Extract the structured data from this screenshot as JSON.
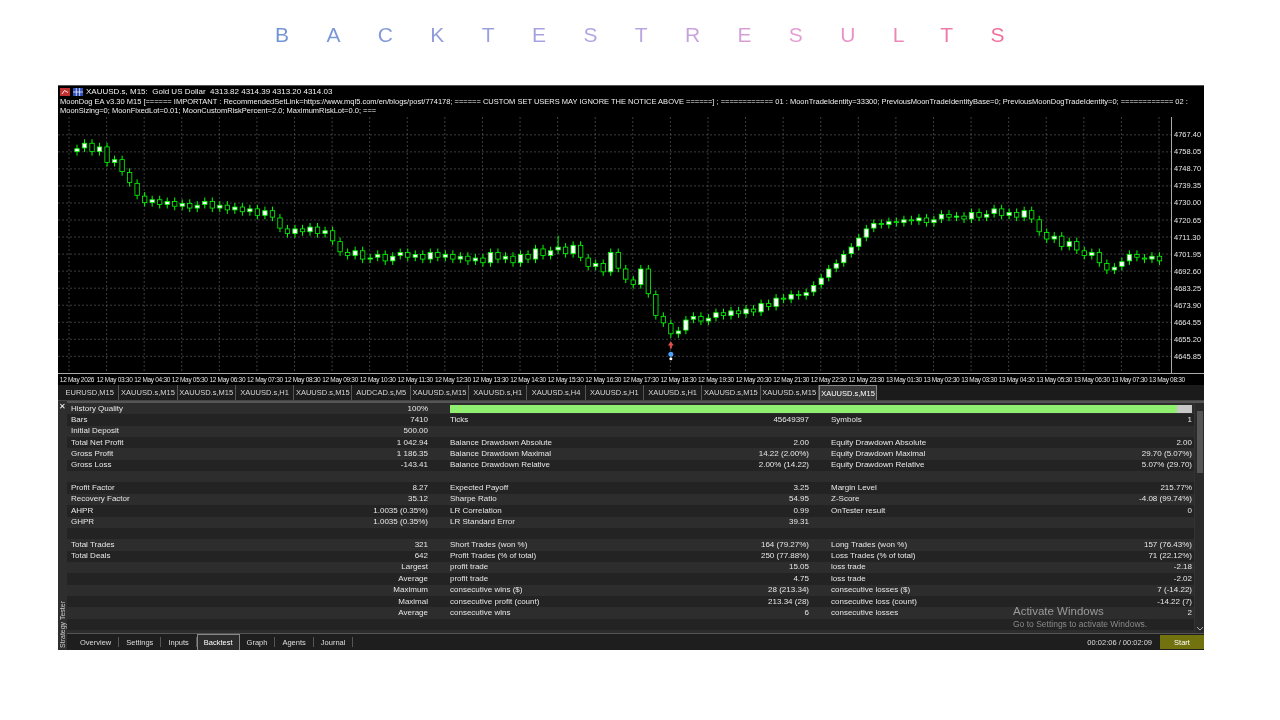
{
  "title": "BACKTEST RESULTS",
  "chart": {
    "header_line": "XAUUSD.s, M15:  Gold US Dollar  4313.82 4314.39 4313.20 4314.03",
    "ea_line": "MoonDog EA v3.30 M15 [====== IMPORTANT : RecommendedSetLink=https://www.mql5.com/en/blogs/post/774178; ====== CUSTOM SET USERS MAY IGNORE THE NOTICE ABOVE ======] ; ============ 01 : MoonTradeIdentity=33300; PreviousMoonTradeIdentityBase=0; PreviousMoonDogTradeIdentity=0; ============ 02 : MoonSizing=0; MoonFixedLot=0.01; MoonCustomRiskPercent=2.0; MaximumRiskLot=0.0; ===",
    "chart_data": {
      "type": "candlestick",
      "categories": [
        "12 May 2026",
        null,
        null,
        null,
        null,
        "12 May 03:30",
        null,
        null,
        null,
        null,
        "12 May 04:30",
        null,
        null,
        null,
        null,
        "12 May 05:30",
        null,
        null,
        null,
        null,
        "12 May 06:30",
        null,
        null,
        null,
        null,
        "12 May 07:30",
        null,
        null,
        null,
        null,
        "12 May 08:30",
        null,
        null,
        null,
        null,
        "12 May 09:30",
        null,
        null,
        null,
        null,
        "12 May 10:30",
        null,
        null,
        null,
        null,
        "12 May 11:30",
        null,
        null,
        null,
        null,
        "12 May 12:30",
        null,
        null,
        null,
        null,
        "12 May 13:30",
        null,
        null,
        null,
        null,
        "12 May 14:30",
        null,
        null,
        null,
        null,
        "12 May 15:30",
        null,
        null,
        null,
        null,
        "12 May 16:30",
        null,
        null,
        null,
        null,
        "12 May 17:30",
        null,
        null,
        null,
        null,
        "12 May 18:30",
        null,
        null,
        null,
        null,
        "12 May 19:30",
        null,
        null,
        null,
        null,
        "12 May 20:30",
        null,
        null,
        null,
        null,
        "12 May 21:30",
        null,
        null,
        null,
        null,
        "12 May 22:30",
        null,
        null,
        null,
        null,
        "12 May 23:30",
        null,
        null,
        null,
        null,
        "13 May 01:30",
        null,
        null,
        null,
        null,
        "13 May 02:30",
        null,
        null,
        null,
        null,
        "13 May 03:30",
        null,
        null,
        null,
        null,
        "13 May 04:30",
        null,
        null,
        null,
        null,
        "13 May 05:30",
        null,
        null,
        null,
        null,
        "13 May 06:30",
        null,
        null,
        null,
        null,
        "13 May 07:30",
        null,
        null,
        null,
        null,
        "13 May 08:30"
      ],
      "grid": true,
      "ylim": [
        4636.7,
        4777.19
      ],
      "ohlc": [
        [
          4758,
          4762,
          4756,
          4760
        ],
        [
          4760,
          4765,
          4758,
          4763
        ],
        [
          4763,
          4765,
          4756,
          4758
        ],
        [
          4758,
          4763,
          4756,
          4761
        ],
        [
          4761,
          4763,
          4750,
          4752
        ],
        [
          4752,
          4756,
          4750,
          4754
        ],
        [
          4754,
          4756,
          4745,
          4747
        ],
        [
          4747,
          4749,
          4739,
          4741
        ],
        [
          4741,
          4743,
          4732,
          4734
        ],
        [
          4734,
          4736,
          4728,
          4730
        ],
        [
          4730,
          4734,
          4728,
          4732
        ],
        [
          4732,
          4734,
          4727,
          4729
        ],
        [
          4729,
          4733,
          4727,
          4731
        ],
        [
          4731,
          4733,
          4726,
          4728
        ],
        [
          4728,
          4732,
          4726,
          4730
        ],
        [
          4730,
          4732,
          4725,
          4727
        ],
        [
          4727,
          4731,
          4725,
          4729
        ],
        [
          4729,
          4733,
          4727,
          4731
        ],
        [
          4731,
          4733,
          4725,
          4727
        ],
        [
          4727,
          4731,
          4725,
          4729
        ],
        [
          4729,
          4731,
          4724,
          4726
        ],
        [
          4726,
          4730,
          4724,
          4728
        ],
        [
          4728,
          4730,
          4723,
          4725
        ],
        [
          4725,
          4729,
          4723,
          4727
        ],
        [
          4727,
          4729,
          4721,
          4723
        ],
        [
          4723,
          4728,
          4721,
          4726
        ],
        [
          4726,
          4728,
          4720,
          4722
        ],
        [
          4722,
          4724,
          4714,
          4716
        ],
        [
          4716,
          4718,
          4711,
          4713
        ],
        [
          4713,
          4718,
          4711,
          4716
        ],
        [
          4716,
          4718,
          4712,
          4714
        ],
        [
          4714,
          4719,
          4712,
          4717
        ],
        [
          4717,
          4719,
          4711,
          4713
        ],
        [
          4713,
          4717,
          4711,
          4715
        ],
        [
          4715,
          4717,
          4707,
          4709
        ],
        [
          4709,
          4711,
          4701,
          4703
        ],
        [
          4703,
          4705,
          4699,
          4701
        ],
        [
          4701,
          4706,
          4699,
          4704
        ],
        [
          4704,
          4706,
          4697,
          4699
        ],
        [
          4699,
          4702,
          4697,
          4700
        ],
        [
          4700,
          4704,
          4698,
          4702
        ],
        [
          4702,
          4704,
          4696,
          4698
        ],
        [
          4698,
          4703,
          4696,
          4701
        ],
        [
          4701,
          4705,
          4699,
          4703
        ],
        [
          4703,
          4705,
          4698,
          4700
        ],
        [
          4700,
          4704,
          4698,
          4702
        ],
        [
          4702,
          4704,
          4697,
          4699
        ],
        [
          4699,
          4705,
          4697,
          4703
        ],
        [
          4703,
          4705,
          4698,
          4700
        ],
        [
          4700,
          4704,
          4698,
          4702
        ],
        [
          4702,
          4704,
          4697,
          4699
        ],
        [
          4699,
          4703,
          4697,
          4701
        ],
        [
          4701,
          4703,
          4696,
          4698
        ],
        [
          4698,
          4702,
          4696,
          4700
        ],
        [
          4700,
          4702,
          4695,
          4697
        ],
        [
          4697,
          4705,
          4695,
          4703
        ],
        [
          4703,
          4705,
          4697,
          4699
        ],
        [
          4699,
          4703,
          4697,
          4701
        ],
        [
          4701,
          4703,
          4695,
          4697
        ],
        [
          4697,
          4704,
          4695,
          4702
        ],
        [
          4702,
          4704,
          4697,
          4699
        ],
        [
          4699,
          4707,
          4697,
          4705
        ],
        [
          4705,
          4707,
          4699,
          4701
        ],
        [
          4701,
          4706,
          4699,
          4704
        ],
        [
          4704,
          4712,
          4702,
          4706
        ],
        [
          4706,
          4708,
          4700,
          4702
        ],
        [
          4702,
          4709,
          4700,
          4707
        ],
        [
          4707,
          4709,
          4698,
          4700
        ],
        [
          4700,
          4702,
          4693,
          4695
        ],
        [
          4695,
          4699,
          4693,
          4697
        ],
        [
          4697,
          4699,
          4690,
          4692
        ],
        [
          4692,
          4705,
          4690,
          4703
        ],
        [
          4703,
          4705,
          4692,
          4694
        ],
        [
          4694,
          4696,
          4686,
          4688
        ],
        [
          4688,
          4690,
          4683,
          4685
        ],
        [
          4685,
          4696,
          4683,
          4694
        ],
        [
          4694,
          4696,
          4678,
          4680
        ],
        [
          4680,
          4682,
          4666,
          4668
        ],
        [
          4668,
          4670,
          4662,
          4664
        ],
        [
          4664,
          4666,
          4656,
          4658
        ],
        [
          4658,
          4662,
          4656,
          4660
        ],
        [
          4660,
          4668,
          4658,
          4666
        ],
        [
          4666,
          4670,
          4664,
          4668
        ],
        [
          4668,
          4670,
          4663,
          4665
        ],
        [
          4665,
          4669,
          4663,
          4667
        ],
        [
          4667,
          4672,
          4665,
          4670
        ],
        [
          4670,
          4672,
          4666,
          4668
        ],
        [
          4668,
          4673,
          4666,
          4671
        ],
        [
          4671,
          4673,
          4667,
          4669
        ],
        [
          4669,
          4674,
          4667,
          4672
        ],
        [
          4672,
          4674,
          4668,
          4670
        ],
        [
          4670,
          4677,
          4668,
          4675
        ],
        [
          4675,
          4677,
          4671,
          4673
        ],
        [
          4673,
          4680,
          4671,
          4678
        ],
        [
          4678,
          4680,
          4675,
          4677
        ],
        [
          4677,
          4682,
          4675,
          4680
        ],
        [
          4680,
          4682,
          4677,
          4679
        ],
        [
          4679,
          4683,
          4677,
          4681
        ],
        [
          4681,
          4687,
          4679,
          4685
        ],
        [
          4685,
          4691,
          4683,
          4689
        ],
        [
          4689,
          4696,
          4687,
          4694
        ],
        [
          4694,
          4699,
          4692,
          4697
        ],
        [
          4697,
          4704,
          4695,
          4702
        ],
        [
          4702,
          4708,
          4700,
          4706
        ],
        [
          4706,
          4713,
          4704,
          4711
        ],
        [
          4711,
          4718,
          4709,
          4716
        ],
        [
          4716,
          4721,
          4714,
          4719
        ],
        [
          4719,
          4721,
          4716,
          4718
        ],
        [
          4718,
          4722,
          4716,
          4720
        ],
        [
          4720,
          4722,
          4717,
          4719
        ],
        [
          4719,
          4723,
          4717,
          4721
        ],
        [
          4721,
          4723,
          4718,
          4720
        ],
        [
          4720,
          4724,
          4718,
          4722
        ],
        [
          4722,
          4724,
          4717,
          4719
        ],
        [
          4719,
          4723,
          4717,
          4721
        ],
        [
          4721,
          4726,
          4719,
          4724
        ],
        [
          4724,
          4726,
          4720,
          4722
        ],
        [
          4722,
          4725,
          4720,
          4723
        ],
        [
          4723,
          4725,
          4719,
          4721
        ],
        [
          4721,
          4727,
          4719,
          4725
        ],
        [
          4725,
          4727,
          4720,
          4722
        ],
        [
          4722,
          4726,
          4720,
          4724
        ],
        [
          4724,
          4729,
          4722,
          4727
        ],
        [
          4727,
          4729,
          4721,
          4723
        ],
        [
          4723,
          4727,
          4721,
          4725
        ],
        [
          4725,
          4727,
          4720,
          4722
        ],
        [
          4722,
          4728,
          4720,
          4726
        ],
        [
          4726,
          4728,
          4719,
          4721
        ],
        [
          4721,
          4723,
          4712,
          4714
        ],
        [
          4714,
          4716,
          4708,
          4710
        ],
        [
          4710,
          4714,
          4708,
          4712
        ],
        [
          4712,
          4714,
          4704,
          4706
        ],
        [
          4706,
          4711,
          4704,
          4709
        ],
        [
          4709,
          4711,
          4702,
          4704
        ],
        [
          4704,
          4706,
          4699,
          4701
        ],
        [
          4701,
          4705,
          4699,
          4703
        ],
        [
          4703,
          4705,
          4695,
          4697
        ],
        [
          4697,
          4699,
          4691,
          4693
        ],
        [
          4693,
          4697,
          4691,
          4695
        ],
        [
          4695,
          4700,
          4693,
          4698
        ],
        [
          4698,
          4704,
          4696,
          4702
        ],
        [
          4702,
          4704,
          4698,
          4700
        ],
        [
          4700,
          4702,
          4697,
          4699
        ],
        [
          4699,
          4703,
          4697,
          4701
        ],
        [
          4701,
          4703,
          4696,
          4698
        ],
        null
      ],
      "yticks": [
        {
          "value": 4767.4,
          "label": "4767.40"
        },
        {
          "value": 4758.05,
          "label": "4758.05"
        },
        {
          "value": 4748.7,
          "label": "4748.70"
        },
        {
          "value": 4739.35,
          "label": "4739.35"
        },
        {
          "value": 4730.0,
          "label": "4730.00"
        },
        {
          "value": 4720.65,
          "label": "4720.65"
        },
        {
          "value": 4711.3,
          "label": "4711.30"
        },
        {
          "value": 4701.95,
          "label": "4701.95"
        },
        {
          "value": 4692.6,
          "label": "4692.60"
        },
        {
          "value": 4683.25,
          "label": "4683.25"
        },
        {
          "value": 4673.9,
          "label": "4673.90"
        },
        {
          "value": 4664.55,
          "label": "4664.55"
        },
        {
          "value": 4655.2,
          "label": "4655.20"
        },
        {
          "value": 4645.85,
          "label": "4645.85"
        }
      ]
    }
  },
  "symbol_tabs": [
    {
      "label": "EURUSD,M15",
      "selected": false
    },
    {
      "label": "XAUUSD.s,M15",
      "selected": false
    },
    {
      "label": "XAUUSD.s,M15",
      "selected": false
    },
    {
      "label": "XAUUSD.s,H1",
      "selected": false
    },
    {
      "label": "XAUUSD.s,M15",
      "selected": false
    },
    {
      "label": "AUDCAD.s,M5",
      "selected": false
    },
    {
      "label": "XAUUSD.s,M15",
      "selected": false
    },
    {
      "label": "XAUUSD.s,H1",
      "selected": false
    },
    {
      "label": "XAUUSD.s,H4",
      "selected": false
    },
    {
      "label": "XAUUSD.s,H1",
      "selected": false
    },
    {
      "label": "XAUUSD.s,H1",
      "selected": false
    },
    {
      "label": "XAUUSD.s,M15",
      "selected": false
    },
    {
      "label": "XAUUSD.s,M15",
      "selected": false
    },
    {
      "label": "XAUUSD.s,M15",
      "selected": true
    }
  ],
  "results": {
    "rows": [
      {
        "kind": "quality",
        "label": "History Quality",
        "value": "100%",
        "level": 0.98
      },
      {
        "kind": "stat",
        "cols": [
          {
            "label": "Bars",
            "value": "7410"
          },
          {
            "label": "Ticks",
            "value": "45649397"
          },
          {
            "label": "Symbols",
            "value": "1"
          }
        ]
      },
      {
        "kind": "stat",
        "cols": [
          {
            "label": "Initial Deposit",
            "value": "500.00"
          }
        ]
      },
      {
        "kind": "stat",
        "cols": [
          {
            "label": "Total Net Profit",
            "value": "1 042.94"
          },
          {
            "label": "Balance Drawdown Absolute",
            "value": "2.00"
          },
          {
            "label": "Equity Drawdown Absolute",
            "value": "2.00"
          }
        ]
      },
      {
        "kind": "stat",
        "cols": [
          {
            "label": "Gross Profit",
            "value": "1 186.35"
          },
          {
            "label": "Balance Drawdown Maximal",
            "value": "14.22 (2.00%)"
          },
          {
            "label": "Equity Drawdown Maximal",
            "value": "29.70 (5.07%)"
          }
        ]
      },
      {
        "kind": "stat",
        "cols": [
          {
            "label": "Gross Loss",
            "value": "-143.41"
          },
          {
            "label": "Balance Drawdown Relative",
            "value": "2.00% (14.22)"
          },
          {
            "label": "Equity Drawdown Relative",
            "value": "5.07% (29.70)"
          }
        ]
      },
      {
        "kind": "blank"
      },
      {
        "kind": "stat",
        "cols": [
          {
            "label": "Profit Factor",
            "value": "8.27"
          },
          {
            "label": "Expected Payoff",
            "value": "3.25"
          },
          {
            "label": "Margin Level",
            "value": "215.77%"
          }
        ]
      },
      {
        "kind": "stat",
        "cols": [
          {
            "label": "Recovery Factor",
            "value": "35.12"
          },
          {
            "label": "Sharpe Ratio",
            "value": "54.95"
          },
          {
            "label": "Z-Score",
            "value": "-4.08 (99.74%)"
          }
        ]
      },
      {
        "kind": "stat",
        "cols": [
          {
            "label": "AHPR",
            "value": "1.0035 (0.35%)"
          },
          {
            "label": "LR Correlation",
            "value": "0.99"
          },
          {
            "label": "OnTester result",
            "value": "0"
          }
        ]
      },
      {
        "kind": "stat",
        "cols": [
          {
            "label": "GHPR",
            "value": "1.0035 (0.35%)"
          },
          {
            "label": "LR Standard Error",
            "value": "39.31"
          }
        ]
      },
      {
        "kind": "blank"
      },
      {
        "kind": "stat",
        "cols": [
          {
            "label": "Total Trades",
            "value": "321"
          },
          {
            "label": "Short Trades (won %)",
            "value": "164 (79.27%)"
          },
          {
            "label": "Long Trades (won %)",
            "value": "157 (76.43%)"
          }
        ]
      },
      {
        "kind": "stat",
        "cols": [
          {
            "label": "Total Deals",
            "value": "642"
          },
          {
            "label": "Profit Trades (% of total)",
            "value": "250 (77.88%)"
          },
          {
            "label": "Loss Trades (% of total)",
            "value": "71 (22.12%)"
          }
        ]
      },
      {
        "kind": "sub",
        "caption": "Largest",
        "cols": [
          {
            "label": "profit trade",
            "value": "15.05"
          },
          {
            "label": "loss trade",
            "value": "-2.18"
          }
        ]
      },
      {
        "kind": "sub",
        "caption": "Average",
        "cols": [
          {
            "label": "profit trade",
            "value": "4.75"
          },
          {
            "label": "loss trade",
            "value": "-2.02"
          }
        ]
      },
      {
        "kind": "sub",
        "caption": "Maximum",
        "cols": [
          {
            "label": "consecutive wins ($)",
            "value": "28 (213.34)"
          },
          {
            "label": "consecutive losses ($)",
            "value": "7 (-14.22)"
          }
        ]
      },
      {
        "kind": "sub",
        "caption": "Maximal",
        "cols": [
          {
            "label": "consecutive profit (count)",
            "value": "213.34 (28)"
          },
          {
            "label": "consecutive loss (count)",
            "value": "-14.22 (7)"
          }
        ]
      },
      {
        "kind": "sub",
        "caption": "Average",
        "cols": [
          {
            "label": "consecutive wins",
            "value": "6"
          },
          {
            "label": "consecutive losses",
            "value": "2"
          }
        ]
      },
      {
        "kind": "blank"
      }
    ]
  },
  "close_glyph": "✕",
  "panel_label": "Strategy Tester",
  "bottom_tabs": [
    {
      "label": "Overview",
      "selected": false
    },
    {
      "label": "Settings",
      "selected": false
    },
    {
      "label": "Inputs",
      "selected": false
    },
    {
      "label": "Backtest",
      "selected": true
    },
    {
      "label": "Graph",
      "selected": false
    },
    {
      "label": "Agents",
      "selected": false
    },
    {
      "label": "Journal",
      "selected": false
    }
  ],
  "elapsed": "00:02:06 / 00:02:09",
  "start_button": "Start",
  "os_notice": {
    "title": "Activate Windows",
    "text": "Go to Settings to activate Windows."
  }
}
